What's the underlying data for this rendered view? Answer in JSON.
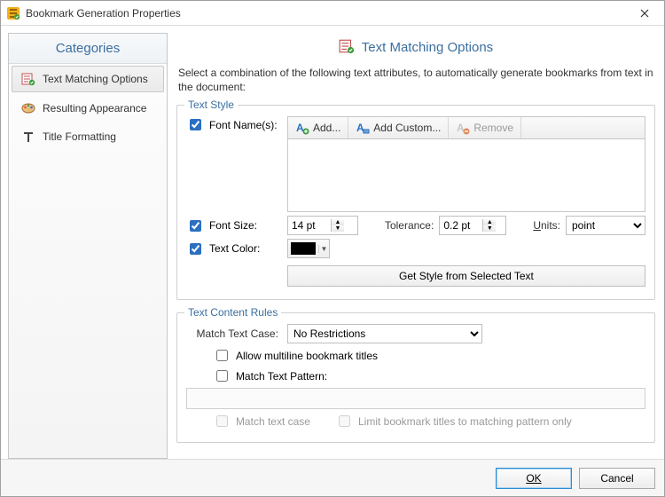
{
  "window": {
    "title": "Bookmark Generation Properties"
  },
  "sidebar": {
    "header": "Categories",
    "items": [
      {
        "label": "Text Matching Options"
      },
      {
        "label": "Resulting Appearance"
      },
      {
        "label": "Title Formatting"
      }
    ]
  },
  "main": {
    "heading": "Text Matching Options",
    "description": "Select a combination of the following text attributes, to automatically generate bookmarks from text in the document:"
  },
  "text_style": {
    "legend": "Text Style",
    "font_names_label": "Font Name(s):",
    "add_btn": "Add...",
    "add_custom_btn": "Add Custom...",
    "remove_btn": "Remove",
    "font_size_label": "Font Size:",
    "font_size_value": "14 pt",
    "tolerance_label": "Tolerance:",
    "tolerance_value": "0.2 pt",
    "units_label": "Units:",
    "units_value": "point",
    "units_options": [
      "point"
    ],
    "text_color_label": "Text Color:",
    "color_value": "#000000",
    "get_style_btn": "Get Style from Selected Text"
  },
  "content_rules": {
    "legend": "Text Content Rules",
    "match_case_label": "Match Text Case:",
    "match_case_value": "No Restrictions",
    "match_case_options": [
      "No Restrictions"
    ],
    "allow_multiline_label": "Allow multiline bookmark titles",
    "match_pattern_label": "Match Text Pattern:",
    "pattern_value": "",
    "match_text_case_sub": "Match text case",
    "limit_titles_label": "Limit bookmark titles to matching pattern only"
  },
  "footer": {
    "ok": "OK",
    "cancel": "Cancel"
  }
}
